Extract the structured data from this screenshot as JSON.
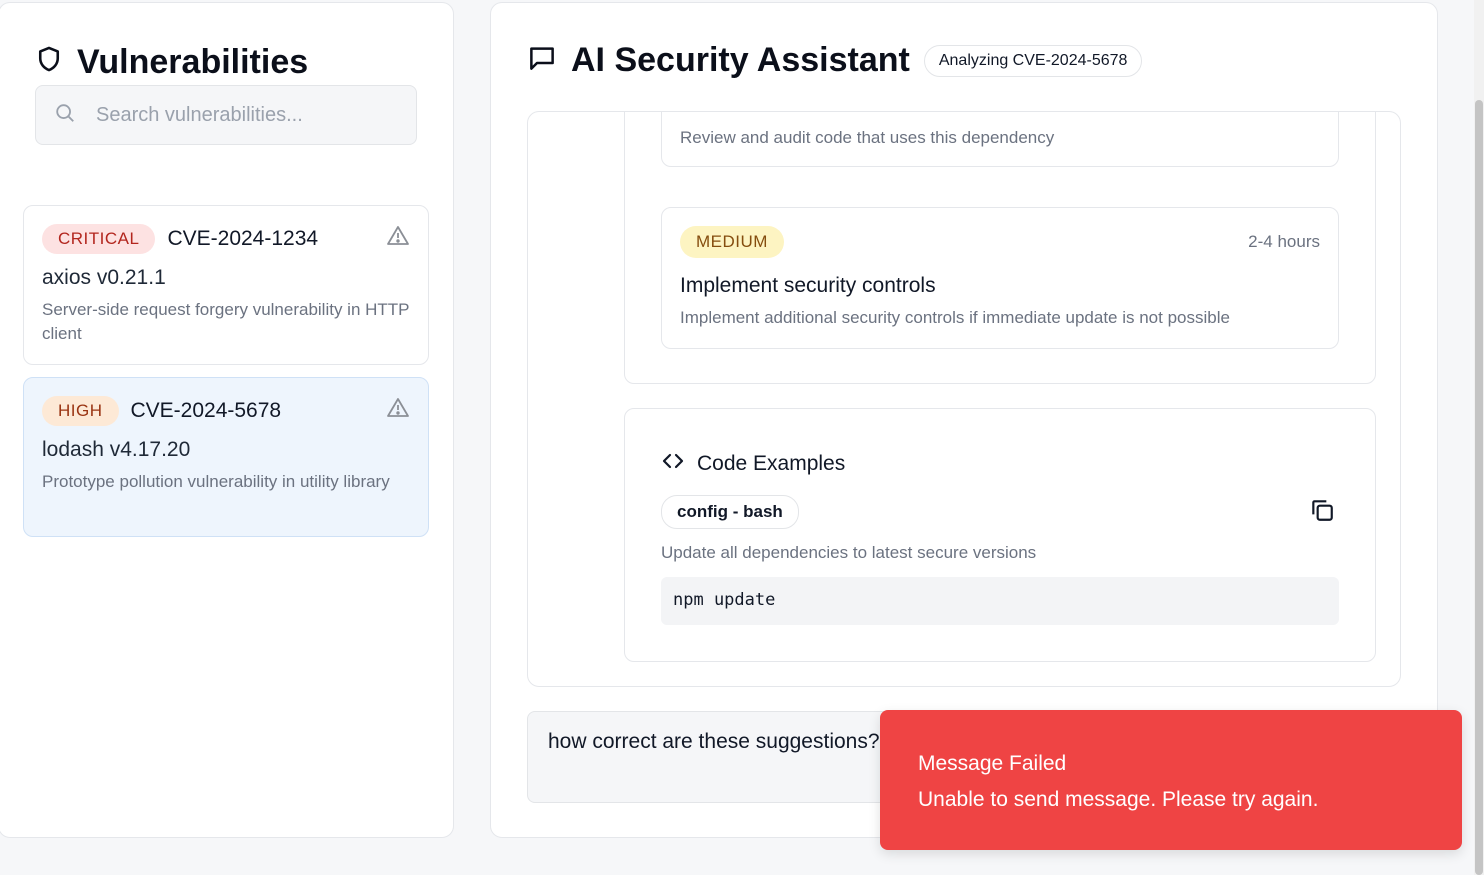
{
  "sidebar": {
    "title": "Vulnerabilities",
    "search_placeholder": "Search vulnerabilities...",
    "items": [
      {
        "severity": "CRITICAL",
        "cve": "CVE-2024-1234",
        "package": "axios v0.21.1",
        "description": "Server-side request forgery vulnerability in HTTP client",
        "selected": false
      },
      {
        "severity": "HIGH",
        "cve": "CVE-2024-5678",
        "package": "lodash v4.17.20",
        "description": "Prototype pollution vulnerability in utility library",
        "selected": true
      }
    ]
  },
  "main": {
    "title": "AI Security Assistant",
    "context_badge": "Analyzing CVE-2024-5678",
    "recommendations": [
      {
        "description": "Review and audit code that uses this dependency"
      },
      {
        "priority": "MEDIUM",
        "effort": "2-4 hours",
        "title": "Implement security controls",
        "description": "Implement additional security controls if immediate update is not possible"
      }
    ],
    "code_examples": {
      "heading": "Code Examples",
      "tag": "config - bash",
      "description": "Update all dependencies to latest secure versions",
      "code": "npm update"
    },
    "message_input": "how correct are these suggestions?"
  },
  "toast": {
    "title": "Message Failed",
    "message": "Unable to send message. Please try again."
  },
  "colors": {
    "critical_bg": "#fde2e2",
    "high_bg": "#fde9d6",
    "medium_bg": "#fdf4c2",
    "toast_bg": "#ef4444",
    "selected_bg": "#eef5fd"
  }
}
